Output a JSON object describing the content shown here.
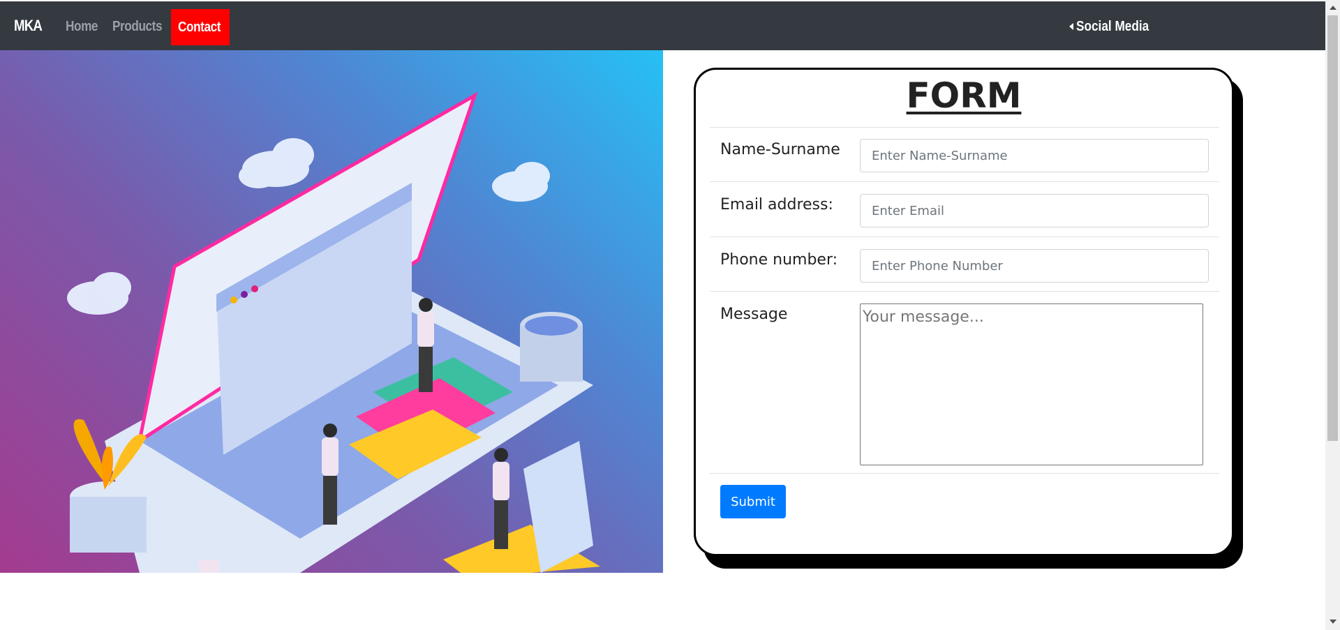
{
  "navbar": {
    "brand": "MKA",
    "links": [
      {
        "label": "Home",
        "active": false
      },
      {
        "label": "Products",
        "active": false
      },
      {
        "label": "Contact",
        "active": true
      }
    ],
    "social_label": "Social Media",
    "active_color": "#ff0000",
    "bg_color": "#343a40"
  },
  "hero": {
    "image": "isometric-workspace-illustration"
  },
  "form": {
    "title": "FORM",
    "fields": [
      {
        "label": "Name-Surname",
        "placeholder": "Enter Name-Surname",
        "value": ""
      },
      {
        "label": "Email address:",
        "placeholder": "Enter Email",
        "value": ""
      },
      {
        "label": "Phone number:",
        "placeholder": "Enter Phone Number",
        "value": ""
      }
    ],
    "message": {
      "label": "Message",
      "placeholder": "Your message...",
      "value": ""
    },
    "submit_label": "Submit",
    "submit_color": "#007bff"
  }
}
